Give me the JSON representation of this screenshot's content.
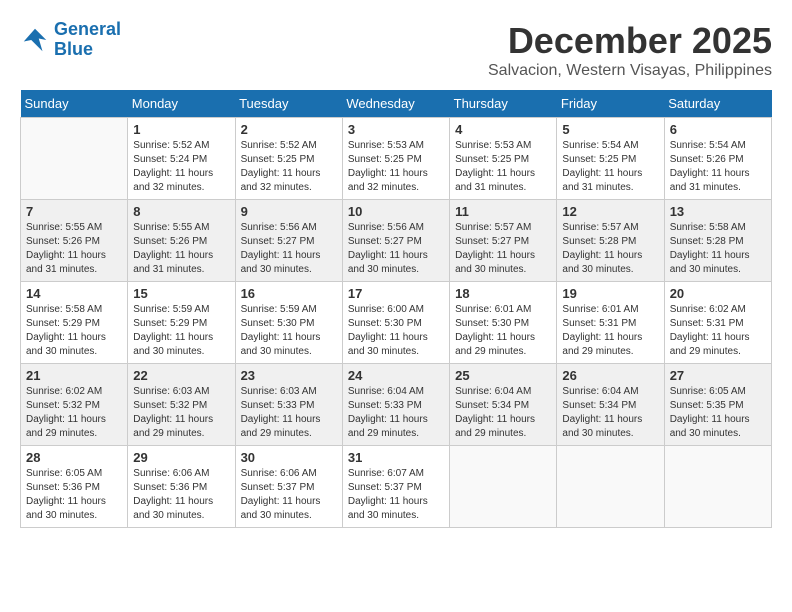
{
  "logo": {
    "line1": "General",
    "line2": "Blue"
  },
  "title": "December 2025",
  "location": "Salvacion, Western Visayas, Philippines",
  "days_of_week": [
    "Sunday",
    "Monday",
    "Tuesday",
    "Wednesday",
    "Thursday",
    "Friday",
    "Saturday"
  ],
  "weeks": [
    [
      {
        "day": "",
        "info": ""
      },
      {
        "day": "1",
        "info": "Sunrise: 5:52 AM\nSunset: 5:24 PM\nDaylight: 11 hours\nand 32 minutes."
      },
      {
        "day": "2",
        "info": "Sunrise: 5:52 AM\nSunset: 5:25 PM\nDaylight: 11 hours\nand 32 minutes."
      },
      {
        "day": "3",
        "info": "Sunrise: 5:53 AM\nSunset: 5:25 PM\nDaylight: 11 hours\nand 32 minutes."
      },
      {
        "day": "4",
        "info": "Sunrise: 5:53 AM\nSunset: 5:25 PM\nDaylight: 11 hours\nand 31 minutes."
      },
      {
        "day": "5",
        "info": "Sunrise: 5:54 AM\nSunset: 5:25 PM\nDaylight: 11 hours\nand 31 minutes."
      },
      {
        "day": "6",
        "info": "Sunrise: 5:54 AM\nSunset: 5:26 PM\nDaylight: 11 hours\nand 31 minutes."
      }
    ],
    [
      {
        "day": "7",
        "info": "Sunrise: 5:55 AM\nSunset: 5:26 PM\nDaylight: 11 hours\nand 31 minutes."
      },
      {
        "day": "8",
        "info": "Sunrise: 5:55 AM\nSunset: 5:26 PM\nDaylight: 11 hours\nand 31 minutes."
      },
      {
        "day": "9",
        "info": "Sunrise: 5:56 AM\nSunset: 5:27 PM\nDaylight: 11 hours\nand 30 minutes."
      },
      {
        "day": "10",
        "info": "Sunrise: 5:56 AM\nSunset: 5:27 PM\nDaylight: 11 hours\nand 30 minutes."
      },
      {
        "day": "11",
        "info": "Sunrise: 5:57 AM\nSunset: 5:27 PM\nDaylight: 11 hours\nand 30 minutes."
      },
      {
        "day": "12",
        "info": "Sunrise: 5:57 AM\nSunset: 5:28 PM\nDaylight: 11 hours\nand 30 minutes."
      },
      {
        "day": "13",
        "info": "Sunrise: 5:58 AM\nSunset: 5:28 PM\nDaylight: 11 hours\nand 30 minutes."
      }
    ],
    [
      {
        "day": "14",
        "info": "Sunrise: 5:58 AM\nSunset: 5:29 PM\nDaylight: 11 hours\nand 30 minutes."
      },
      {
        "day": "15",
        "info": "Sunrise: 5:59 AM\nSunset: 5:29 PM\nDaylight: 11 hours\nand 30 minutes."
      },
      {
        "day": "16",
        "info": "Sunrise: 5:59 AM\nSunset: 5:30 PM\nDaylight: 11 hours\nand 30 minutes."
      },
      {
        "day": "17",
        "info": "Sunrise: 6:00 AM\nSunset: 5:30 PM\nDaylight: 11 hours\nand 30 minutes."
      },
      {
        "day": "18",
        "info": "Sunrise: 6:01 AM\nSunset: 5:30 PM\nDaylight: 11 hours\nand 29 minutes."
      },
      {
        "day": "19",
        "info": "Sunrise: 6:01 AM\nSunset: 5:31 PM\nDaylight: 11 hours\nand 29 minutes."
      },
      {
        "day": "20",
        "info": "Sunrise: 6:02 AM\nSunset: 5:31 PM\nDaylight: 11 hours\nand 29 minutes."
      }
    ],
    [
      {
        "day": "21",
        "info": "Sunrise: 6:02 AM\nSunset: 5:32 PM\nDaylight: 11 hours\nand 29 minutes."
      },
      {
        "day": "22",
        "info": "Sunrise: 6:03 AM\nSunset: 5:32 PM\nDaylight: 11 hours\nand 29 minutes."
      },
      {
        "day": "23",
        "info": "Sunrise: 6:03 AM\nSunset: 5:33 PM\nDaylight: 11 hours\nand 29 minutes."
      },
      {
        "day": "24",
        "info": "Sunrise: 6:04 AM\nSunset: 5:33 PM\nDaylight: 11 hours\nand 29 minutes."
      },
      {
        "day": "25",
        "info": "Sunrise: 6:04 AM\nSunset: 5:34 PM\nDaylight: 11 hours\nand 29 minutes."
      },
      {
        "day": "26",
        "info": "Sunrise: 6:04 AM\nSunset: 5:34 PM\nDaylight: 11 hours\nand 30 minutes."
      },
      {
        "day": "27",
        "info": "Sunrise: 6:05 AM\nSunset: 5:35 PM\nDaylight: 11 hours\nand 30 minutes."
      }
    ],
    [
      {
        "day": "28",
        "info": "Sunrise: 6:05 AM\nSunset: 5:36 PM\nDaylight: 11 hours\nand 30 minutes."
      },
      {
        "day": "29",
        "info": "Sunrise: 6:06 AM\nSunset: 5:36 PM\nDaylight: 11 hours\nand 30 minutes."
      },
      {
        "day": "30",
        "info": "Sunrise: 6:06 AM\nSunset: 5:37 PM\nDaylight: 11 hours\nand 30 minutes."
      },
      {
        "day": "31",
        "info": "Sunrise: 6:07 AM\nSunset: 5:37 PM\nDaylight: 11 hours\nand 30 minutes."
      },
      {
        "day": "",
        "info": ""
      },
      {
        "day": "",
        "info": ""
      },
      {
        "day": "",
        "info": ""
      }
    ]
  ]
}
